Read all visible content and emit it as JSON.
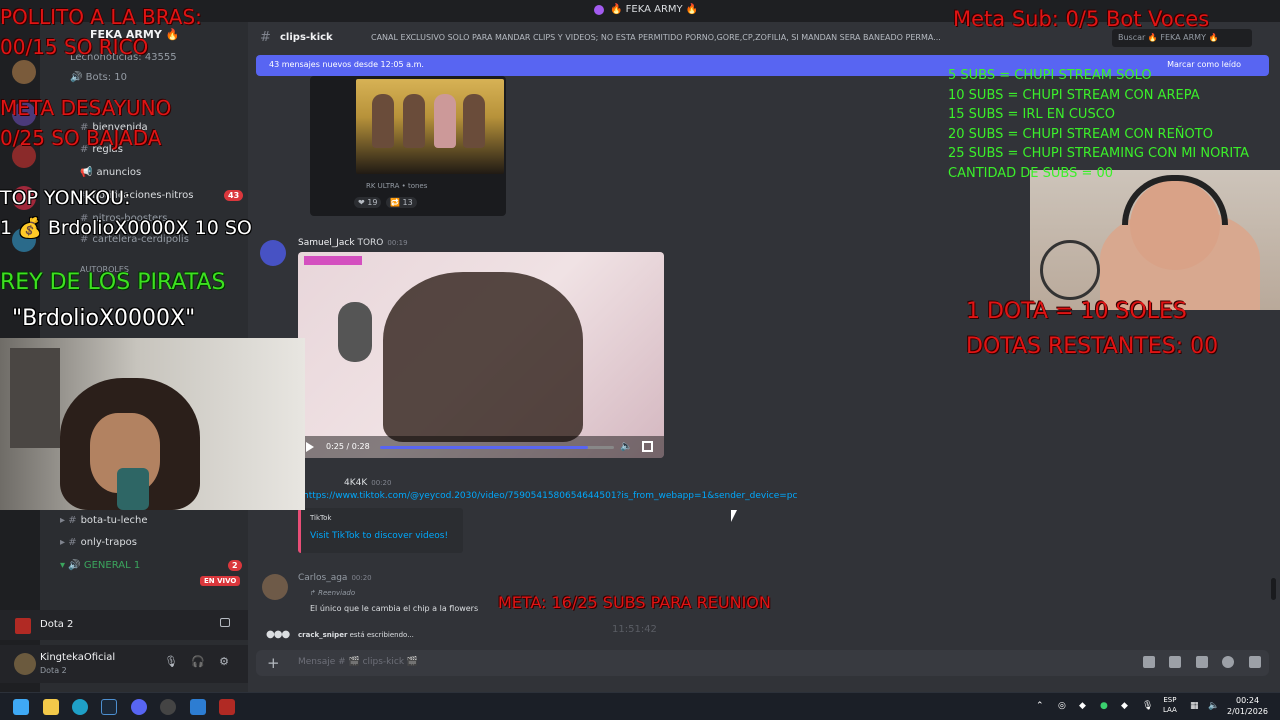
{
  "window": {
    "title": "🔥 FEKA ARMY 🔥"
  },
  "server": {
    "name": "FEKA ARMY 🔥"
  },
  "sidebar": {
    "items": [
      {
        "label": "Lechonoticias: 43555"
      },
      {
        "label": "Bots: 10"
      },
      {
        "label": "bienvenida"
      },
      {
        "label": "reglas"
      },
      {
        "label": "anuncios"
      },
      {
        "label": "notificaciones-nitros"
      },
      {
        "label": "nitros-boosters"
      },
      {
        "label": "cartelera-cerdipolis"
      },
      {
        "label": "AUTOROLES"
      },
      {
        "label": "bota-tu-leche"
      },
      {
        "label": "only-trapos"
      },
      {
        "label": "GENERAL 1"
      }
    ],
    "badge_43": "43",
    "badge_2": "2",
    "live_label": "EN VIVO"
  },
  "game_panel": {
    "name": "Dota 2"
  },
  "user_panel": {
    "name": "KingtekaOficial",
    "status": "Dota 2"
  },
  "channel": {
    "name": "clips-kick",
    "topic": "CANAL EXCLUSIVO SOLO PARA MANDAR CLIPS Y VIDEOS; NO ESTA PERMITIDO PORNO,GORE,CP,ZOFILIA, SI MANDAN SERA BANEADO PERMA...",
    "search_placeholder": "Buscar 🔥 FEKA ARMY 🔥"
  },
  "new_messages_bar": {
    "text": "43 mensajes nuevos desde 12:05 a.m.",
    "mark_read": "Marcar como leído"
  },
  "messages": {
    "embed_meta": "RK ULTRA • tones",
    "reactions": [
      "19",
      "13"
    ],
    "msg1_author": "Samuel_Jack",
    "msg1_role": "TORO",
    "msg1_time": "00:19",
    "video_time": "0:25 / 0:28",
    "video_progress": 0.89,
    "msg2_author_tag": "4K4K",
    "msg2_time": "00:20",
    "link": "https://www.tiktok.com/@yeycod.2030/video/7590541580654644501?is_from_webapp=1&sender_device=pc",
    "tiktok_provider": "TikTok",
    "tiktok_link": "Visit TikTok to discover videos!",
    "msg3_author": "Carlos_aga",
    "msg3_time": "00:20",
    "forwarded_label": "Reenviado",
    "forwarded_text": "El único que le cambia el chip a la flowers",
    "typing_user": "crack_sniper",
    "typing_suffix": "está escribiendo...",
    "blur_time": "11:51:42"
  },
  "composer": {
    "placeholder": "Mensaje # 🎬 clips-kick 🎬"
  },
  "overlays": {
    "pollito_line1": "POLLITO A LA BRAS:",
    "pollito_line2": "00/15 SO RICO",
    "desayuno_line1": "META DESAYUNO",
    "desayuno_line2": "0/25 SO BAJADA",
    "top_yonkou_title": "TOP YONKOU:",
    "top_yonkou_entry": "1 💰 BrdolioX0000X 10 SO",
    "rey_line1": "REY DE LOS PIRATAS",
    "rey_line2": "\"BrdolioX0000X\"",
    "meta_sub": "Meta Sub: 0/5 Bot Voces",
    "subs_goals": [
      "5 SUBS = CHUPI STREAM SOLO",
      "10 SUBS = CHUPI STREAM CON AREPA",
      "15 SUBS = IRL EN CUSCO",
      "20 SUBS = CHUPI STREAM CON REÑOTO",
      "25 SUBS = CHUPI STREAMING CON MI ÑORITA",
      "CANTIDAD DE SUBS = 00"
    ],
    "dota_line1": "1 DOTA = 10 SOLES",
    "dota_line2": "DOTAS RESTANTES: 00",
    "meta_reunion": "META: 16/25 SUBS PARA REUNION"
  },
  "taskbar": {
    "lang_line1": "ESP",
    "lang_line2": "LAA",
    "time": "00:24",
    "date": "2/01/2026"
  }
}
